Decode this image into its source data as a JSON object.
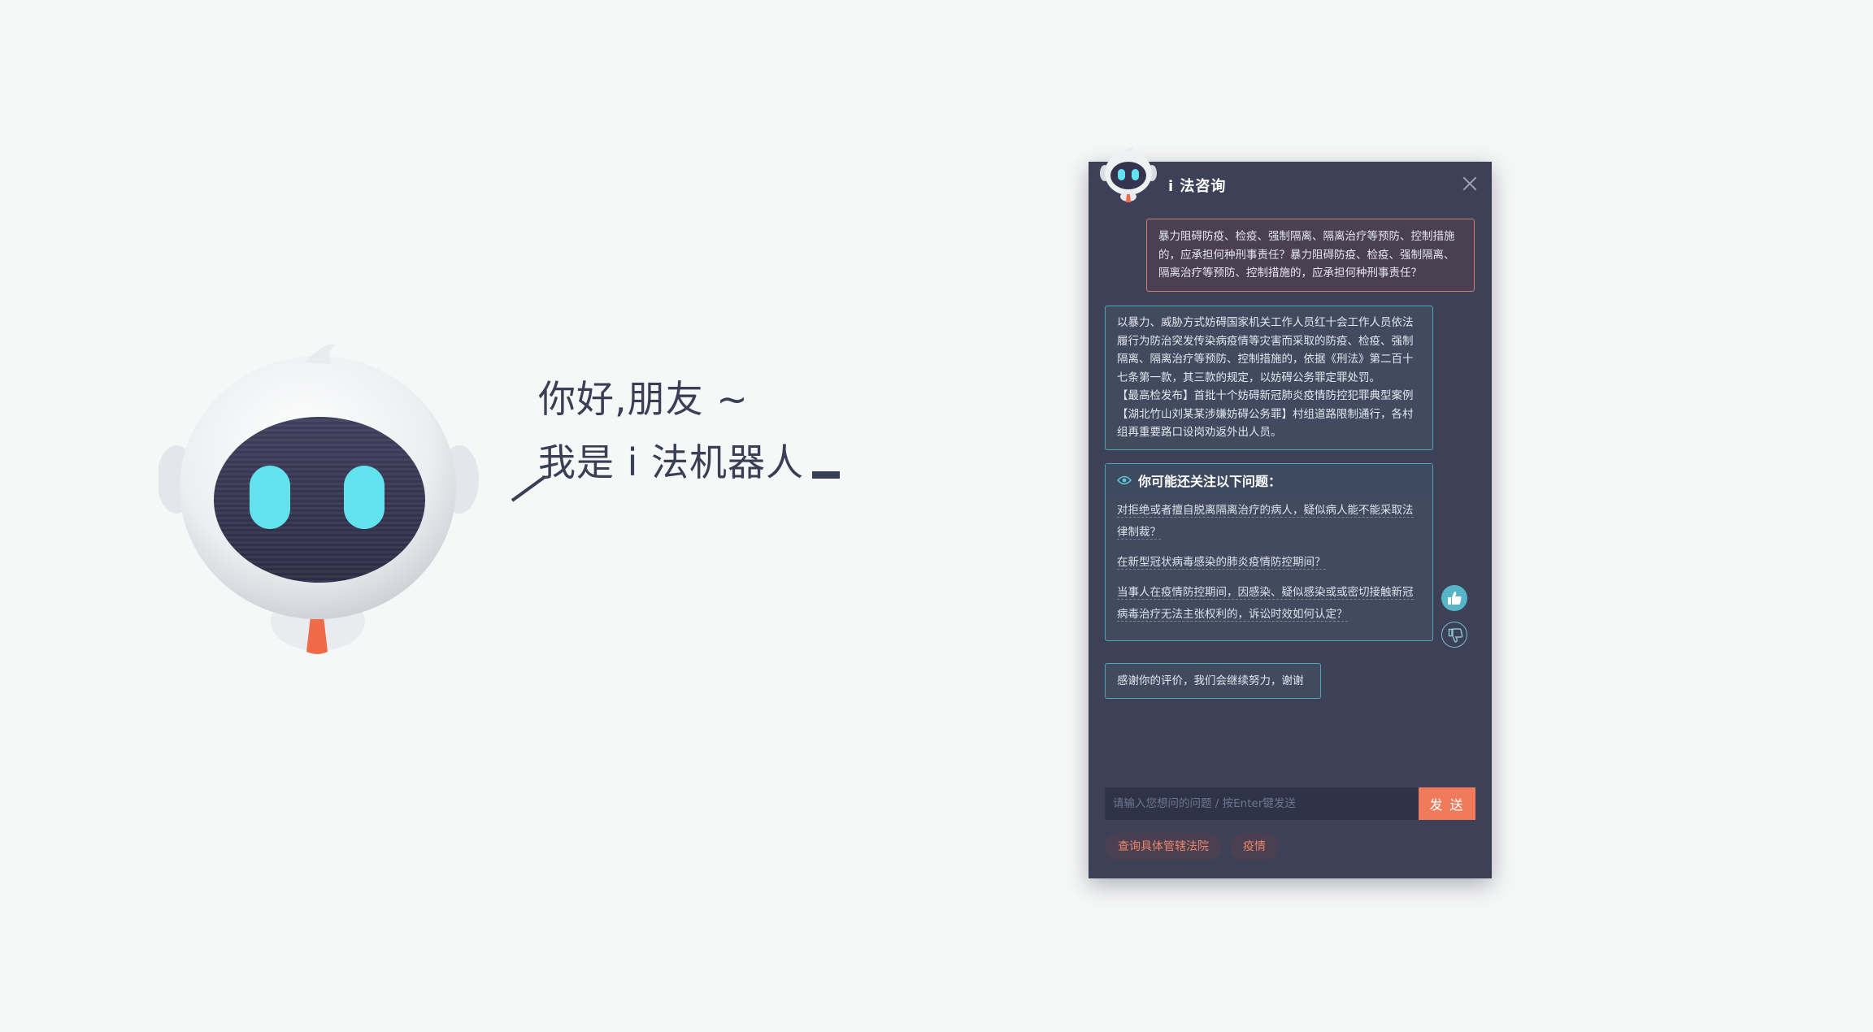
{
  "greeting": {
    "line1": "你好,朋友 ~",
    "line2": "我是 i 法机器人"
  },
  "chat": {
    "title": "i 法咨询",
    "user_message": "暴力阻碍防疫、检疫、强制隔离、隔离治疗等预防、控制措施的，应承担何种刑事责任？暴力阻碍防疫、检疫、强制隔离、隔离治疗等预防、控制措施的，应承担何种刑事责任？",
    "bot_answer": {
      "line1": "以暴力、威胁方式妨碍国家机关工作人员红十会工作人员依法履行为防治突发传染病疫情等灾害而采取的防疫、检疫、强制隔离、隔离治疗等预防、控制措施的，依据《刑法》第二百十七条第一款，其三款的规定，以妨碍公务罪定罪处罚。",
      "line2": "【最高检发布】首批十个妨碍新冠肺炎疫情防控犯罪典型案例",
      "line3": "【湖北竹山刘某某涉嫌妨碍公务罪】村组道路限制通行，各村组再重要路口设岗劝返外出人员。"
    },
    "suggestions_title": "你可能还关注以下问题：",
    "suggestions": [
      "对拒绝或者擅自脱离隔离治疗的病人，疑似病人能不能采取法律制裁？",
      "在新型冠状病毒感染的肺炎疫情防控期间？",
      "当事人在疫情防控期间，因感染、疑似感染或或密切接触新冠病毒治疗无法主张权利的，诉讼时效如何认定？"
    ],
    "thanks_message": "感谢你的评价，我们会继续努力，谢谢",
    "input_placeholder": "请输入您想问的问题 / 按Enter键发送",
    "send_label": "发 送",
    "tags": [
      "查询具体管辖法院",
      "疫情"
    ]
  },
  "colors": {
    "panel_bg": "#3d4158",
    "accent_teal": "#4ea5b8",
    "accent_orange": "#f07a5c",
    "page_bg": "#f6f7f7"
  },
  "icons": [
    "robot-mascot",
    "robot-avatar-icon",
    "close-icon",
    "eye-icon",
    "thumbs-up-icon",
    "thumbs-down-icon"
  ]
}
